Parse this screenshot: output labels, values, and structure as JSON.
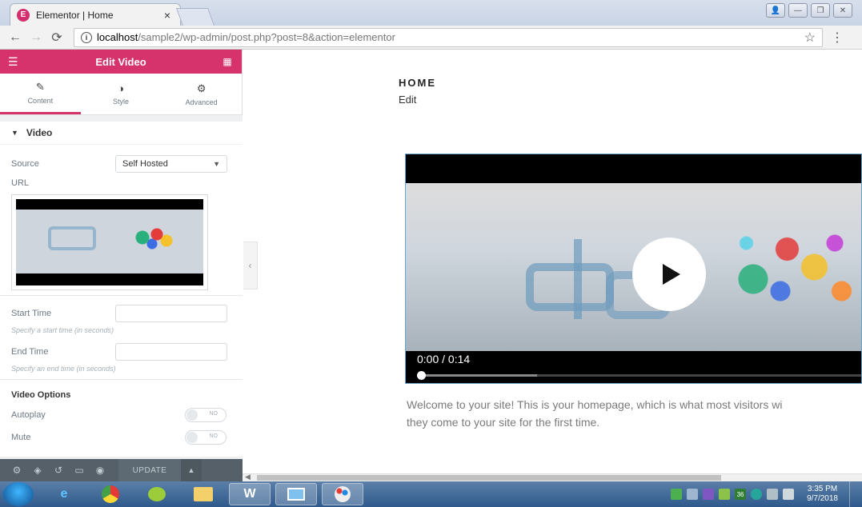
{
  "browser": {
    "tab_title": "Elementor | Home",
    "tab_favicon_text": "E",
    "url_host": "localhost",
    "url_path": "/sample2/wp-admin/post.php?post=8&action=elementor"
  },
  "panel": {
    "header_title": "Edit Video",
    "tabs": [
      {
        "label": "Content",
        "icon": "pencil-icon",
        "active": true
      },
      {
        "label": "Style",
        "icon": "contrast-icon",
        "active": false
      },
      {
        "label": "Advanced",
        "icon": "gear-icon",
        "active": false
      }
    ],
    "section_title": "Video",
    "source_label": "Source",
    "source_value": "Self Hosted",
    "url_label": "URL",
    "start_time_label": "Start Time",
    "start_time_hint": "Specify a start time (in seconds)",
    "end_time_label": "End Time",
    "end_time_hint": "Specify an end time (in seconds)",
    "video_options_label": "Video Options",
    "autoplay_label": "Autoplay",
    "autoplay_state": "NO",
    "mute_label": "Mute",
    "mute_state": "NO",
    "footer_update_label": "UPDATE",
    "accent_color": "#d6326c"
  },
  "preview": {
    "page_title": "HOME",
    "edit_link": "Edit",
    "video_time": "0:00 / 0:14",
    "video_progress": 0.0,
    "welcome_line1": "Welcome to your site! This is your homepage, which is what most visitors wi",
    "welcome_line2": "they come to your site for the first time."
  },
  "taskbar": {
    "tray_badge": "36",
    "clock_time": "3:35 PM",
    "clock_date": "9/7/2018"
  }
}
